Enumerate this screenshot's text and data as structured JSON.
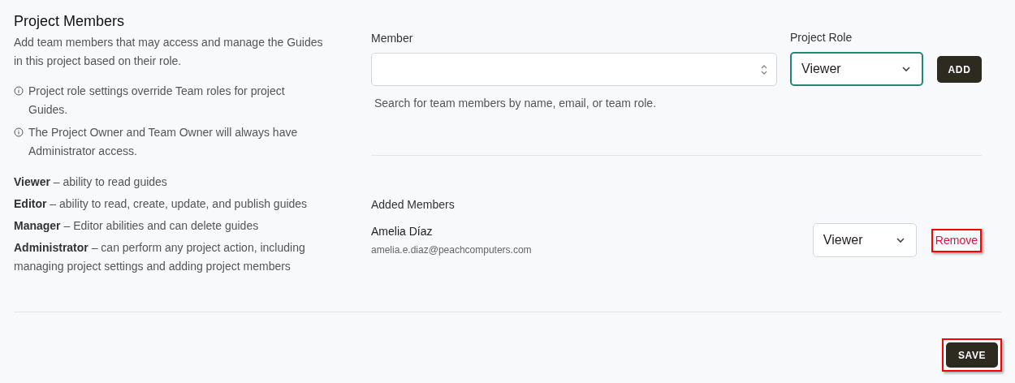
{
  "section": {
    "title": "Project Members",
    "description": "Add team members that may access and manage the Guides in this project based on their role."
  },
  "notes": [
    "Project role settings override Team roles for project Guides.",
    "The Project Owner and Team Owner will always have Administrator access."
  ],
  "roles": [
    "**Viewer** – ability to read guides",
    "**Editor** – ability to read, create, update, and publish guides",
    "**Manager** – Editor abilities and can delete guides",
    "**Administrator** – can perform any project action, including managing project settings and adding project members"
  ],
  "member_field": {
    "label": "Member",
    "help": "Search for team members by name, email, or team role."
  },
  "role_field": {
    "label": "Project Role",
    "value": "Viewer",
    "focused": true
  },
  "add_button": {
    "label": "ADD"
  },
  "added_members": {
    "title": "Added Members",
    "members": [
      {
        "name": "Amelia Díaz",
        "email": "amelia.e.diaz@peachcomputers.com",
        "role": "Viewer",
        "remove": {
          "label": "Remove",
          "highlighted": true
        }
      }
    ]
  },
  "save_button": {
    "label": "SAVE",
    "highlighted": true
  }
}
